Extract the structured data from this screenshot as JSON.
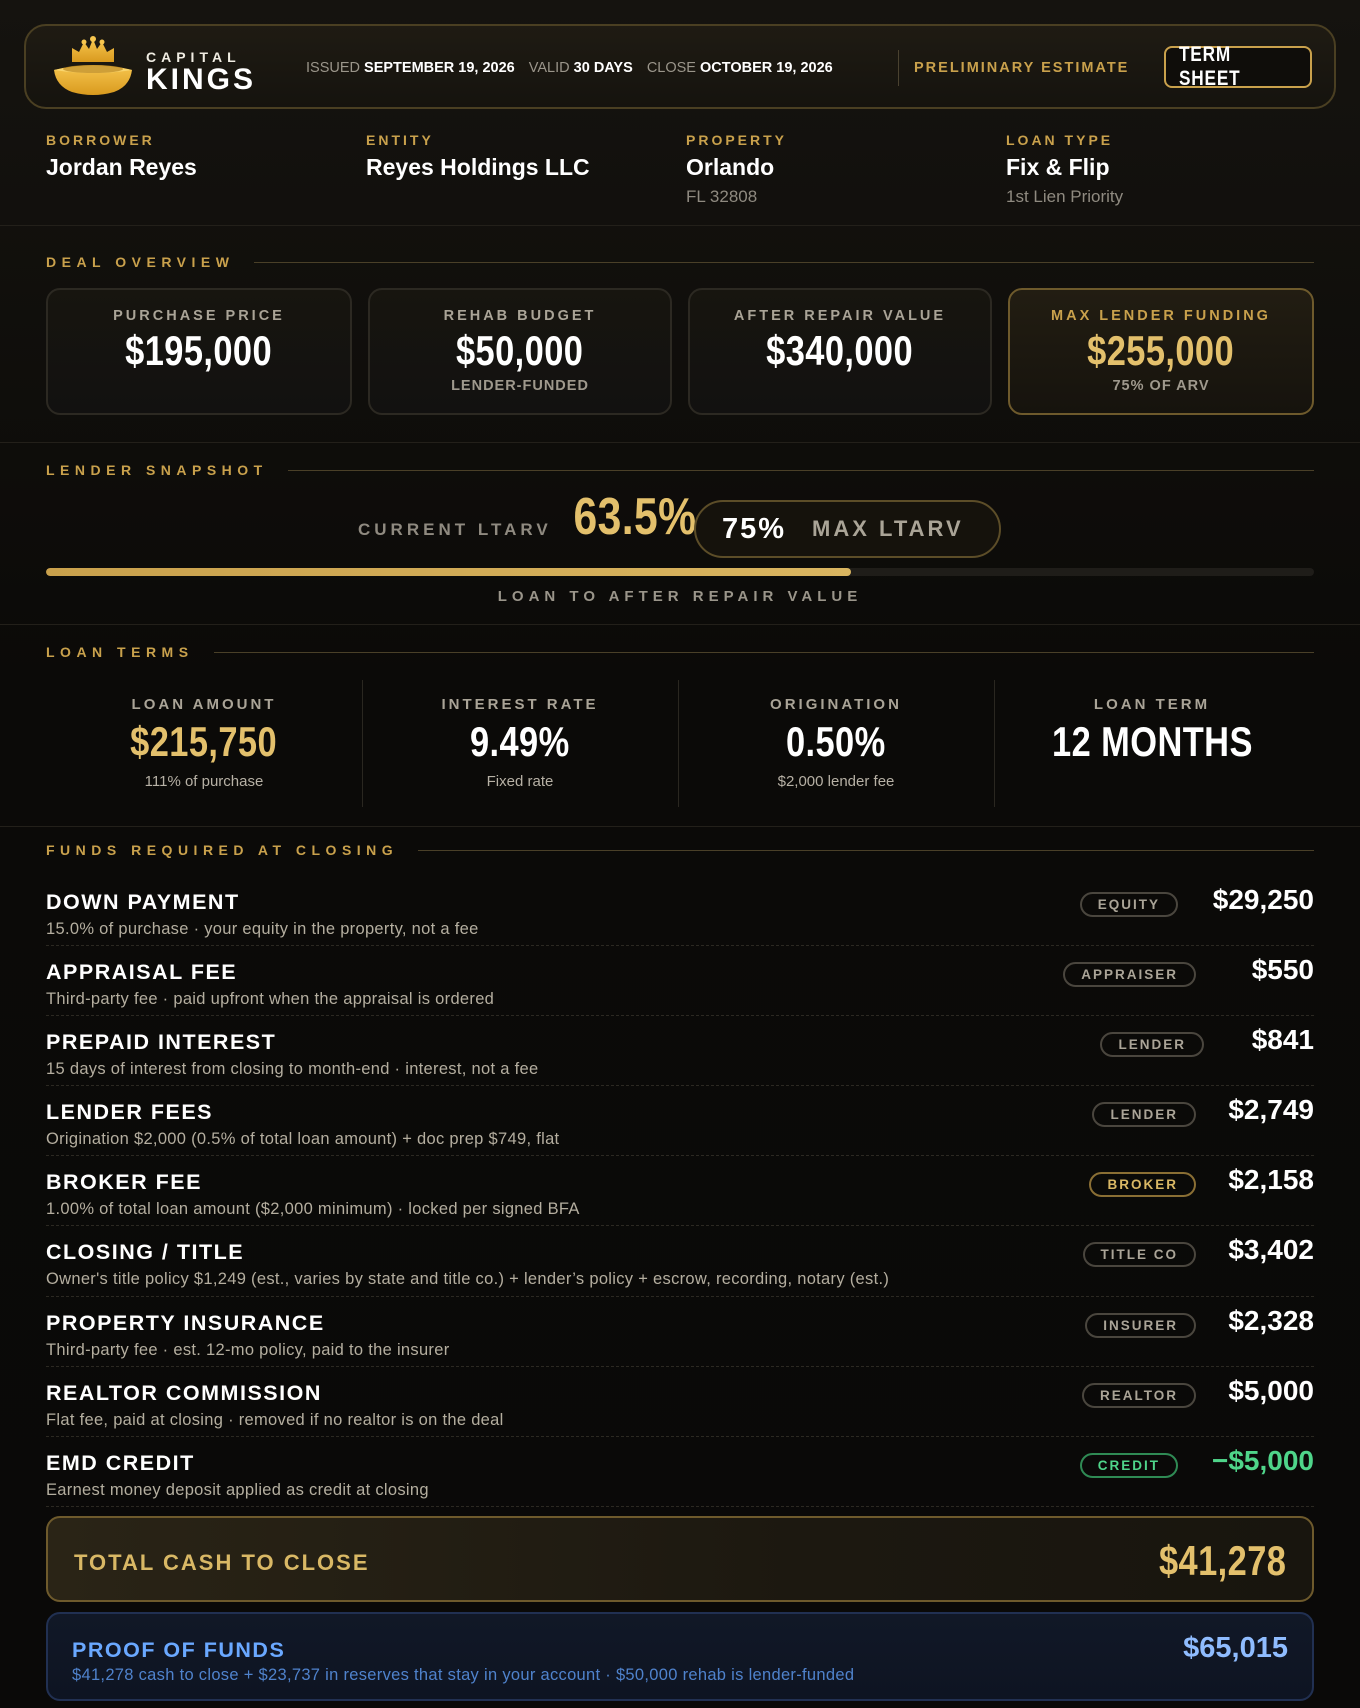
{
  "header": {
    "brand_top": "CAPITAL",
    "brand_bottom": "KINGS",
    "issued_label": "ISSUED",
    "issued_value": "SEPTEMBER 19, 2026",
    "valid_label": "VALID",
    "valid_value": "30 DAYS",
    "close_label": "CLOSE",
    "close_value": "OCTOBER 19, 2026",
    "status": "PRELIMINARY ESTIMATE",
    "doc_type": "TERM SHEET",
    "accent_color": "#c9a14c"
  },
  "parties": [
    {
      "label": "BORROWER",
      "value": "Jordan Reyes",
      "sub": ""
    },
    {
      "label": "ENTITY",
      "value": "Reyes Holdings LLC",
      "sub": ""
    },
    {
      "label": "PROPERTY",
      "value": "Orlando",
      "sub": "FL 32808"
    },
    {
      "label": "LOAN TYPE",
      "value": "Fix & Flip",
      "sub": "1st Lien Priority"
    }
  ],
  "deal_overview": {
    "title": "DEAL OVERVIEW",
    "cards": [
      {
        "label": "PURCHASE PRICE",
        "value": "$195,000",
        "sub": ""
      },
      {
        "label": "REHAB BUDGET",
        "value": "$50,000",
        "sub": "LENDER-FUNDED"
      },
      {
        "label": "AFTER REPAIR VALUE",
        "value": "$340,000",
        "sub": ""
      },
      {
        "label": "MAX LENDER FUNDING",
        "value": "$255,000",
        "sub": "75% OF ARV"
      }
    ]
  },
  "snapshot": {
    "title": "LENDER SNAPSHOT",
    "current_label": "CURRENT LTARV",
    "current_value": "63.5%",
    "max_value": "75%",
    "max_label": "MAX LTARV",
    "bar_fraction": 0.635,
    "bar_label": "LOAN TO AFTER REPAIR VALUE"
  },
  "loan_terms": {
    "title": "LOAN TERMS",
    "items": [
      {
        "label": "LOAN AMOUNT",
        "value": "$215,750",
        "sub": "111% of purchase"
      },
      {
        "label": "INTEREST RATE",
        "value": "9.49%",
        "sub": "Fixed rate"
      },
      {
        "label": "ORIGINATION",
        "value": "0.50%",
        "sub": "$2,000 lender fee"
      },
      {
        "label": "LOAN TERM",
        "value": "12 MONTHS",
        "sub": ""
      }
    ]
  },
  "funds": {
    "title": "FUNDS REQUIRED AT CLOSING",
    "rows": [
      {
        "title": "DOWN PAYMENT",
        "desc": "15.0% of purchase · your equity in the property, not a fee",
        "tag": "EQUITY",
        "amount": "$29,250"
      },
      {
        "title": "APPRAISAL FEE",
        "desc": "Third-party fee · paid upfront when the appraisal is ordered",
        "tag": "APPRAISER",
        "amount": "$550"
      },
      {
        "title": "PREPAID INTEREST",
        "desc": "15 days of interest from closing to month-end · interest, not a fee",
        "tag": "LENDER",
        "amount": "$841"
      },
      {
        "title": "LENDER FEES",
        "desc": "Origination $2,000 (0.5% of total loan amount) + doc prep $749, flat",
        "tag": "LENDER",
        "amount": "$2,749"
      },
      {
        "title": "BROKER FEE",
        "desc": "1.00% of total loan amount ($2,000 minimum) · locked per signed BFA",
        "tag": "BROKER",
        "amount": "$2,158"
      },
      {
        "title": "CLOSING / TITLE",
        "desc": "Owner's title policy $1,249 (est., varies by state and title co.) + lender’s policy + escrow, recording, notary (est.)",
        "tag": "TITLE CO",
        "amount": "$3,402"
      },
      {
        "title": "PROPERTY INSURANCE",
        "desc": "Third-party fee · est. 12-mo policy, paid to the insurer",
        "tag": "INSURER",
        "amount": "$2,328"
      },
      {
        "title": "REALTOR COMMISSION",
        "desc": "Flat fee, paid at closing · removed if no realtor is on the deal",
        "tag": "REALTOR",
        "amount": "$5,000"
      },
      {
        "title": "EMD CREDIT",
        "desc": "Earnest money deposit applied as credit at closing",
        "tag": "CREDIT",
        "amount": "−$5,000"
      }
    ],
    "total_label": "TOTAL CASH TO CLOSE",
    "total_value": "$41,278"
  },
  "proof_of_funds": {
    "title": "PROOF OF FUNDS",
    "desc": "$41,278 cash to close + $23,737 in reserves that stay in your account · $50,000 rehab is lender-funded",
    "value": "$65,015"
  }
}
